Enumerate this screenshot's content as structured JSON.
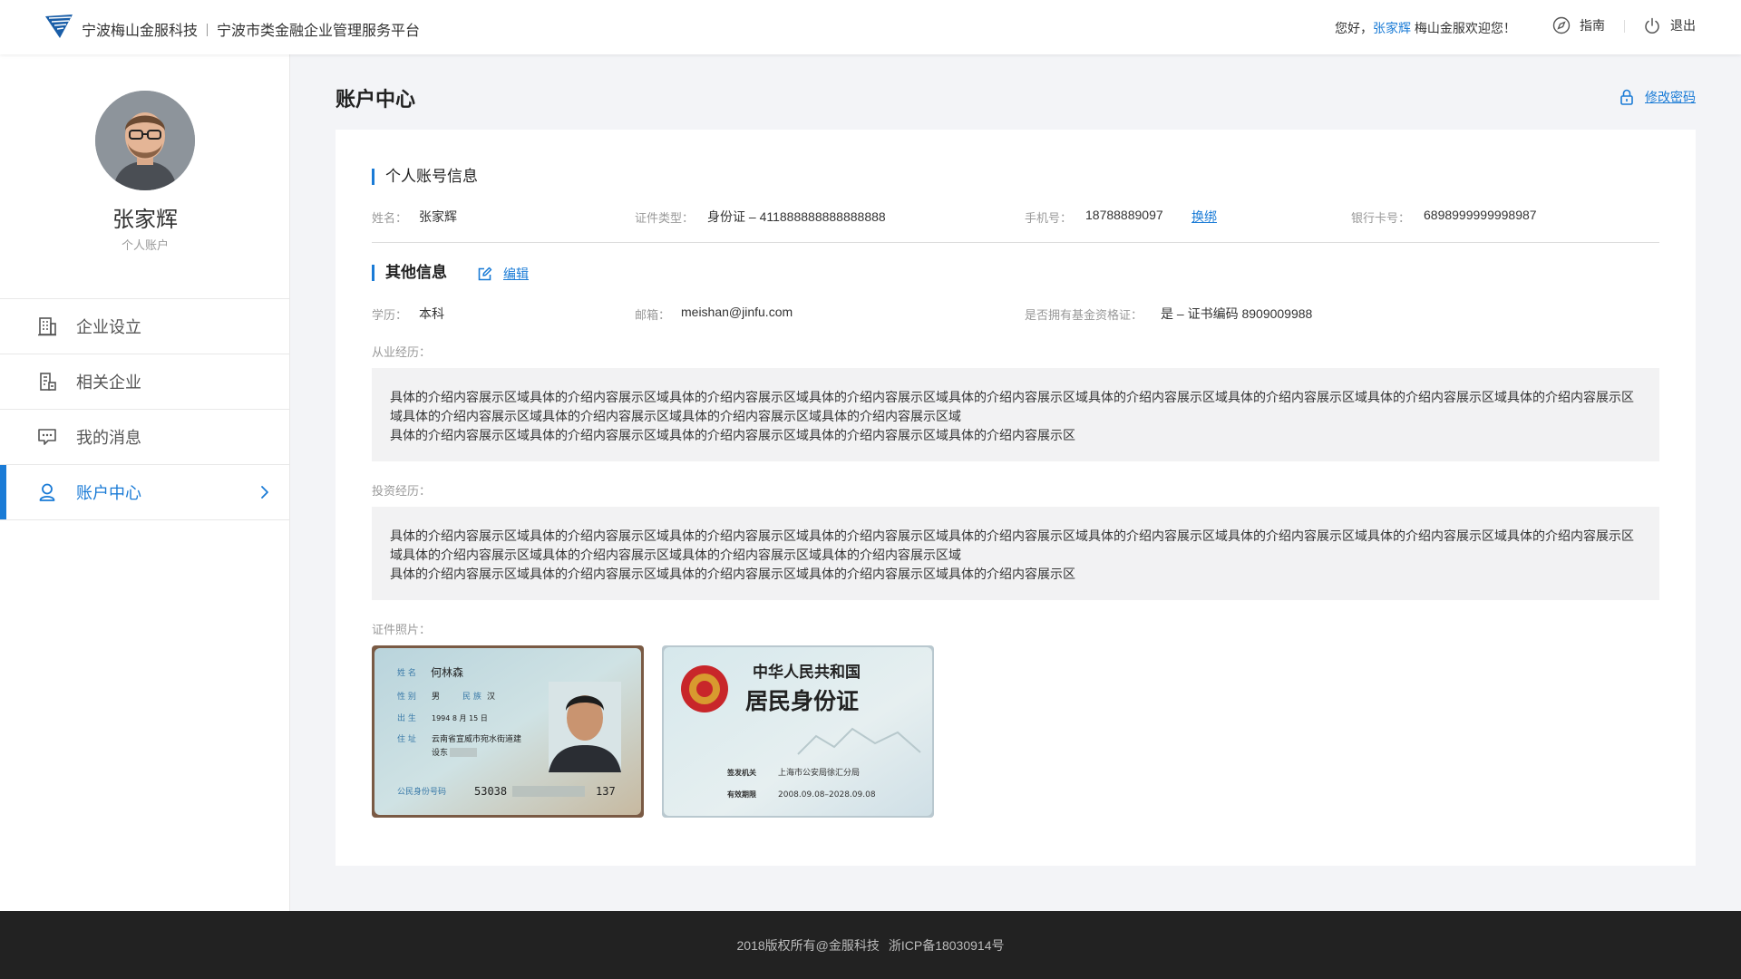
{
  "header": {
    "company": "宁波梅山金服科技",
    "platform": "宁波市类金融企业管理服务平台",
    "greeting_prefix": "您好，",
    "user_name": "张家辉",
    "greeting_suffix": " 梅山金服欢迎您！",
    "guide_label": "指南",
    "logout_label": "退出"
  },
  "sidebar": {
    "name": "张家辉",
    "role": "个人账户",
    "items": [
      {
        "label": "企业设立",
        "icon": "building-icon"
      },
      {
        "label": "相关企业",
        "icon": "related-company-icon"
      },
      {
        "label": "我的消息",
        "icon": "message-icon"
      },
      {
        "label": "账户中心",
        "icon": "user-icon",
        "active": true
      }
    ]
  },
  "main": {
    "title": "账户中心",
    "change_password": "修改密码",
    "personal": {
      "title": "个人账号信息",
      "name_label": "姓名：",
      "name_value": "张家辉",
      "id_label": "证件类型：",
      "id_value": "身份证 – 411888888888888888",
      "phone_label": "手机号：",
      "phone_value": "18788889097",
      "rebind": "换绑",
      "bank_label": "银行卡号：",
      "bank_value": "6898999999998987"
    },
    "other": {
      "title": "其他信息",
      "edit": "编辑",
      "edu_label": "学历：",
      "edu_value": "本科",
      "email_label": "邮箱：",
      "email_value": "meishan@jinfu.com",
      "fund_label": "是否拥有基金资格证：",
      "fund_value": "是 – 证书编码 8909009988",
      "career_label": "从业经历：",
      "career_lines": [
        "具体的介绍内容展示区域具体的介绍内容展示区域具体的介绍内容展示区域具体的介绍内容展示区域具体的介绍内容展示区域具体的介绍内容展示区域具体的介绍内容展示区域具体的介绍内容展示区域具体的介绍内容展示区",
        "域具体的介绍内容展示区域具体的介绍内容展示区域具体的介绍内容展示区域具体的介绍内容展示区域",
        "具体的介绍内容展示区域具体的介绍内容展示区域具体的介绍内容展示区域具体的介绍内容展示区域具体的介绍内容展示区"
      ],
      "invest_label": "投资经历：",
      "invest_lines": [
        "具体的介绍内容展示区域具体的介绍内容展示区域具体的介绍内容展示区域具体的介绍内容展示区域具体的介绍内容展示区域具体的介绍内容展示区域具体的介绍内容展示区域具体的介绍内容展示区域具体的介绍内容展示区",
        "域具体的介绍内容展示区域具体的介绍内容展示区域具体的介绍内容展示区域具体的介绍内容展示区域",
        "具体的介绍内容展示区域具体的介绍内容展示区域具体的介绍内容展示区域具体的介绍内容展示区域具体的介绍内容展示区"
      ],
      "photo_label": "证件照片：",
      "id_front": {
        "name_key": "姓 名",
        "name": "何林森",
        "sex_key": "性 别",
        "sex": "男",
        "ethnic_key": "民 族",
        "ethnic": "汉",
        "birth_key": "出 生",
        "birth": "1994  8  月 15 日",
        "addr_key": "住 址",
        "addr": "云南省宣威市宛水街道建",
        "addr2": "设东",
        "num_key": "公民身份号码",
        "num_start": "53038",
        "num_end": "137"
      },
      "id_back": {
        "country": "中华人民共和国",
        "card_title": "居民身份证",
        "issuer_key": "签发机关",
        "issuer": "上海市公安局徐汇分局",
        "valid_key": "有效期限",
        "valid": "2008.09.08–2028.09.08"
      }
    }
  },
  "footer": {
    "copyright": "2018版权所有@金服科技",
    "icp": "浙ICP备18030914号"
  },
  "colors": {
    "accent": "#1a7bd6",
    "footer_bg": "#222222"
  }
}
